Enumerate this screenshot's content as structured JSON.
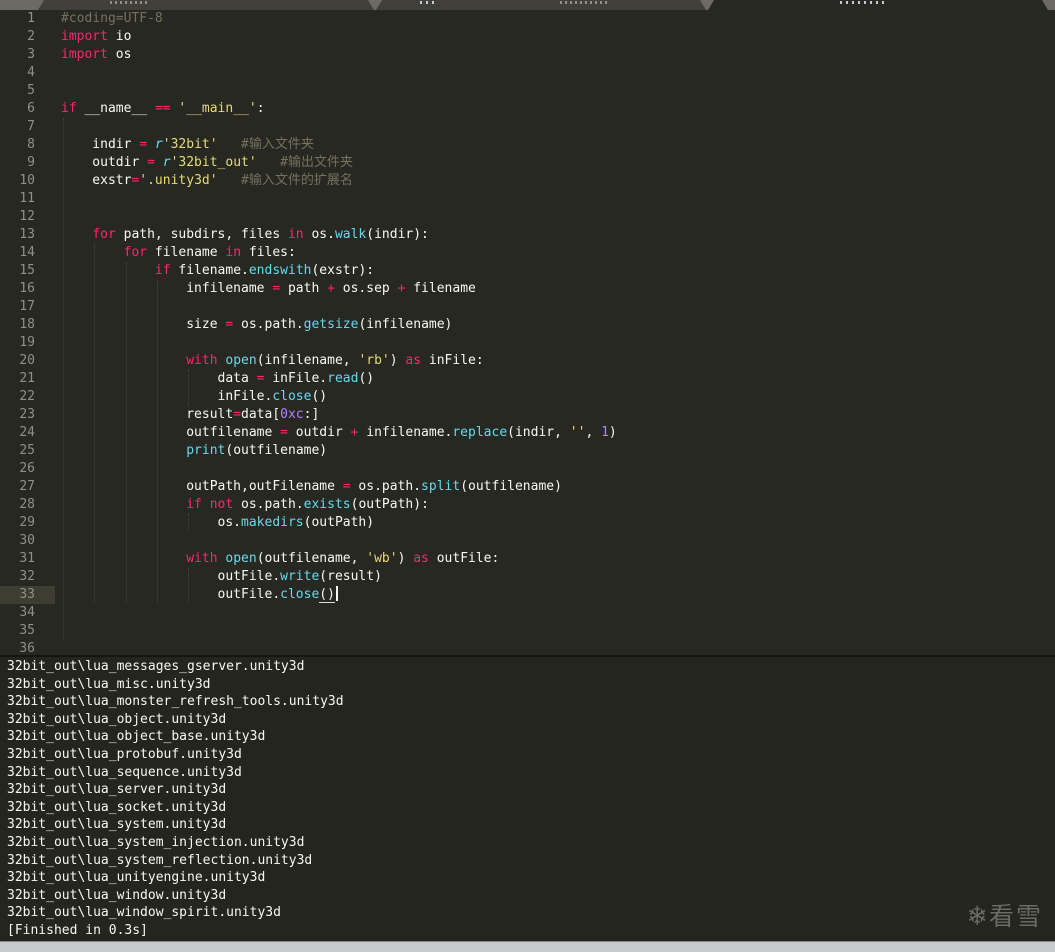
{
  "tab_bar": {
    "tab_count": 3,
    "active_index": 2
  },
  "colors": {
    "editor_background": "#272822",
    "keyword": "#f92672",
    "function_call": "#66d9ef",
    "string": "#e6db74",
    "number": "#ae81ff",
    "comment": "#75715e",
    "text": "#f8f8f2",
    "line_number": "#8f908a",
    "gutter_highlight": "#3e3d32"
  },
  "editor": {
    "language": "python",
    "current_line": 33,
    "lines": [
      {
        "n": 1,
        "tokens": [
          [
            "c",
            "#coding=UTF-8"
          ]
        ]
      },
      {
        "n": 2,
        "tokens": [
          [
            "k",
            "import"
          ],
          [
            "p",
            " io"
          ]
        ]
      },
      {
        "n": 3,
        "tokens": [
          [
            "k",
            "import"
          ],
          [
            "p",
            " os"
          ]
        ]
      },
      {
        "n": 4,
        "tokens": []
      },
      {
        "n": 5,
        "tokens": []
      },
      {
        "n": 6,
        "tokens": [
          [
            "k",
            "if"
          ],
          [
            "p",
            " __name__ "
          ],
          [
            "k",
            "=="
          ],
          [
            "p",
            " "
          ],
          [
            "s",
            "'__main__'"
          ],
          [
            "p",
            ":"
          ]
        ]
      },
      {
        "n": 7,
        "tokens": []
      },
      {
        "n": 8,
        "tokens": [
          [
            "p",
            "    indir "
          ],
          [
            "k",
            "="
          ],
          [
            "p",
            " "
          ],
          [
            "r",
            "r"
          ],
          [
            "s",
            "'32bit'"
          ],
          [
            "p",
            "   "
          ],
          [
            "c",
            "#输入文件夹"
          ]
        ]
      },
      {
        "n": 9,
        "tokens": [
          [
            "p",
            "    outdir "
          ],
          [
            "k",
            "="
          ],
          [
            "p",
            " "
          ],
          [
            "r",
            "r"
          ],
          [
            "s",
            "'32bit_out'"
          ],
          [
            "p",
            "   "
          ],
          [
            "c",
            "#输出文件夹"
          ]
        ]
      },
      {
        "n": 10,
        "tokens": [
          [
            "p",
            "    exstr"
          ],
          [
            "k",
            "="
          ],
          [
            "s",
            "'.unity3d'"
          ],
          [
            "p",
            "   "
          ],
          [
            "c",
            "#输入文件的扩展名"
          ]
        ]
      },
      {
        "n": 11,
        "tokens": []
      },
      {
        "n": 12,
        "tokens": []
      },
      {
        "n": 13,
        "tokens": [
          [
            "p",
            "    "
          ],
          [
            "k",
            "for"
          ],
          [
            "p",
            " path, subdirs, files "
          ],
          [
            "k",
            "in"
          ],
          [
            "p",
            " os."
          ],
          [
            "f",
            "walk"
          ],
          [
            "p",
            "(indir):"
          ]
        ]
      },
      {
        "n": 14,
        "tokens": [
          [
            "p",
            "        "
          ],
          [
            "k",
            "for"
          ],
          [
            "p",
            " filename "
          ],
          [
            "k",
            "in"
          ],
          [
            "p",
            " files:"
          ]
        ]
      },
      {
        "n": 15,
        "tokens": [
          [
            "p",
            "            "
          ],
          [
            "k",
            "if"
          ],
          [
            "p",
            " filename."
          ],
          [
            "f",
            "endswith"
          ],
          [
            "p",
            "(exstr):"
          ]
        ]
      },
      {
        "n": 16,
        "tokens": [
          [
            "p",
            "                infilename "
          ],
          [
            "k",
            "="
          ],
          [
            "p",
            " path "
          ],
          [
            "k",
            "+"
          ],
          [
            "p",
            " os.sep "
          ],
          [
            "k",
            "+"
          ],
          [
            "p",
            " filename"
          ]
        ]
      },
      {
        "n": 17,
        "tokens": []
      },
      {
        "n": 18,
        "tokens": [
          [
            "p",
            "                size "
          ],
          [
            "k",
            "="
          ],
          [
            "p",
            " os.path."
          ],
          [
            "f",
            "getsize"
          ],
          [
            "p",
            "(infilename)"
          ]
        ]
      },
      {
        "n": 19,
        "tokens": []
      },
      {
        "n": 20,
        "tokens": [
          [
            "p",
            "                "
          ],
          [
            "k",
            "with"
          ],
          [
            "p",
            " "
          ],
          [
            "f",
            "open"
          ],
          [
            "p",
            "(infilename, "
          ],
          [
            "s",
            "'rb'"
          ],
          [
            "p",
            ") "
          ],
          [
            "k",
            "as"
          ],
          [
            "p",
            " inFile:"
          ]
        ]
      },
      {
        "n": 21,
        "tokens": [
          [
            "p",
            "                    data "
          ],
          [
            "k",
            "="
          ],
          [
            "p",
            " inFile."
          ],
          [
            "f",
            "read"
          ],
          [
            "p",
            "()"
          ]
        ]
      },
      {
        "n": 22,
        "tokens": [
          [
            "p",
            "                    inFile."
          ],
          [
            "f",
            "close"
          ],
          [
            "p",
            "()"
          ]
        ]
      },
      {
        "n": 23,
        "tokens": [
          [
            "p",
            "                result"
          ],
          [
            "k",
            "="
          ],
          [
            "p",
            "data["
          ],
          [
            "n2",
            "0xc"
          ],
          [
            "p",
            ":]"
          ]
        ]
      },
      {
        "n": 24,
        "tokens": [
          [
            "p",
            "                outfilename "
          ],
          [
            "k",
            "="
          ],
          [
            "p",
            " outdir "
          ],
          [
            "k",
            "+"
          ],
          [
            "p",
            " infilename."
          ],
          [
            "f",
            "replace"
          ],
          [
            "p",
            "(indir, "
          ],
          [
            "s",
            "''"
          ],
          [
            "p",
            ", "
          ],
          [
            "n2",
            "1"
          ],
          [
            "p",
            ")"
          ]
        ]
      },
      {
        "n": 25,
        "tokens": [
          [
            "p",
            "                "
          ],
          [
            "f",
            "print"
          ],
          [
            "p",
            "(outfilename)"
          ]
        ]
      },
      {
        "n": 26,
        "tokens": []
      },
      {
        "n": 27,
        "tokens": [
          [
            "p",
            "                outPath,outFilename "
          ],
          [
            "k",
            "="
          ],
          [
            "p",
            " os.path."
          ],
          [
            "f",
            "split"
          ],
          [
            "p",
            "(outfilename)"
          ]
        ]
      },
      {
        "n": 28,
        "tokens": [
          [
            "p",
            "                "
          ],
          [
            "k",
            "if"
          ],
          [
            "p",
            " "
          ],
          [
            "k",
            "not"
          ],
          [
            "p",
            " os.path."
          ],
          [
            "f",
            "exists"
          ],
          [
            "p",
            "(outPath):"
          ]
        ]
      },
      {
        "n": 29,
        "tokens": [
          [
            "p",
            "                    os."
          ],
          [
            "f",
            "makedirs"
          ],
          [
            "p",
            "(outPath)"
          ]
        ]
      },
      {
        "n": 30,
        "tokens": []
      },
      {
        "n": 31,
        "tokens": [
          [
            "p",
            "                "
          ],
          [
            "k",
            "with"
          ],
          [
            "p",
            " "
          ],
          [
            "f",
            "open"
          ],
          [
            "p",
            "(outfilename, "
          ],
          [
            "s",
            "'wb'"
          ],
          [
            "p",
            ") "
          ],
          [
            "k",
            "as"
          ],
          [
            "p",
            " outFile:"
          ]
        ]
      },
      {
        "n": 32,
        "tokens": [
          [
            "p",
            "                    outFile."
          ],
          [
            "f",
            "write"
          ],
          [
            "p",
            "(result)"
          ]
        ]
      },
      {
        "n": 33,
        "current": true,
        "cursor": true,
        "tokens": [
          [
            "p",
            "                    outFile."
          ],
          [
            "f",
            "close"
          ],
          [
            "u",
            "()"
          ]
        ]
      },
      {
        "n": 34,
        "tokens": []
      },
      {
        "n": 35,
        "tokens": []
      },
      {
        "n": 36,
        "tokens": []
      }
    ]
  },
  "output": {
    "lines": [
      "32bit_out\\lua_messages_gserver.unity3d",
      "32bit_out\\lua_misc.unity3d",
      "32bit_out\\lua_monster_refresh_tools.unity3d",
      "32bit_out\\lua_object.unity3d",
      "32bit_out\\lua_object_base.unity3d",
      "32bit_out\\lua_protobuf.unity3d",
      "32bit_out\\lua_sequence.unity3d",
      "32bit_out\\lua_server.unity3d",
      "32bit_out\\lua_socket.unity3d",
      "32bit_out\\lua_system.unity3d",
      "32bit_out\\lua_system_injection.unity3d",
      "32bit_out\\lua_system_reflection.unity3d",
      "32bit_out\\lua_unityengine.unity3d",
      "32bit_out\\lua_window.unity3d",
      "32bit_out\\lua_window_spirit.unity3d",
      "[Finished in 0.3s]"
    ]
  },
  "watermark": {
    "icon": "❄",
    "text": "看雪"
  }
}
